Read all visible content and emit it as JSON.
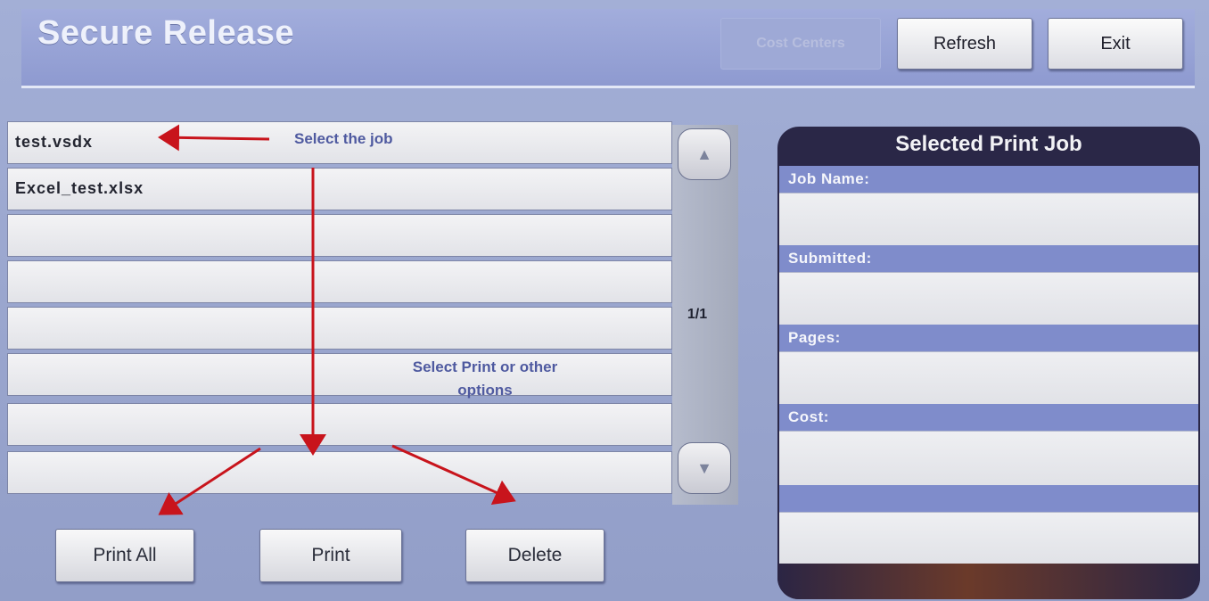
{
  "header": {
    "title": "Secure Release",
    "buttons": {
      "cost_centers": "Cost Centers",
      "refresh": "Refresh",
      "exit": "Exit"
    }
  },
  "job_list": {
    "rows": [
      "test.vsdx",
      "Excel_test.xlsx",
      "",
      "",
      "",
      "",
      "",
      ""
    ],
    "page_indicator": "1/1"
  },
  "actions": {
    "print_all": "Print All",
    "print": "Print",
    "delete": "Delete"
  },
  "selected_job": {
    "title": "Selected Print Job",
    "labels": {
      "job_name": "Job Name:",
      "submitted": "Submitted:",
      "pages": "Pages:",
      "cost": "Cost:"
    },
    "values": {
      "job_name": "",
      "submitted": "",
      "pages": "",
      "cost": ""
    }
  },
  "annotations": {
    "select_job": "Select the job",
    "select_print_line1": "Select Print or other",
    "select_print_line2": "options"
  },
  "colors": {
    "background": "#9aa6cf",
    "panel": "#2a2747",
    "annotation_text": "#4f5aa0",
    "arrow": "#c8141c"
  }
}
